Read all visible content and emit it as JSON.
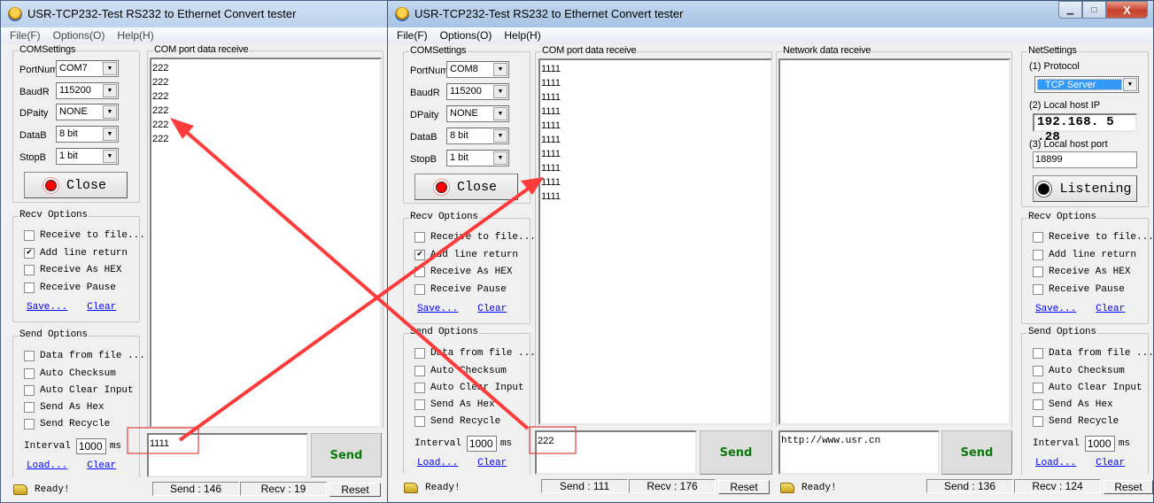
{
  "app": {
    "title": "USR-TCP232-Test  RS232 to Ethernet Convert tester",
    "menu": [
      "File(F)",
      "Options(O)",
      "Help(H)"
    ],
    "window_controls": {
      "minimize": "▁",
      "maximize": "□",
      "close": "X"
    }
  },
  "left_window": {
    "com_settings": {
      "label": "COMSettings",
      "fields": [
        {
          "label": "PortNum",
          "value": "COM7"
        },
        {
          "label": "BaudR",
          "value": "115200"
        },
        {
          "label": "DPaity",
          "value": "NONE"
        },
        {
          "label": "DataB",
          "value": "8 bit"
        },
        {
          "label": "StopB",
          "value": "1 bit"
        }
      ],
      "button_label": "Close"
    },
    "recv_options": {
      "label": "Recv Options",
      "items": [
        {
          "label": "Receive to file...",
          "checked": false
        },
        {
          "label": "Add line return",
          "checked": true
        },
        {
          "label": "Receive As HEX",
          "checked": false
        },
        {
          "label": "Receive Pause",
          "checked": false
        }
      ],
      "save_link": "Save...",
      "clear_link": "Clear"
    },
    "send_options": {
      "label": "Send Options",
      "items": [
        {
          "label": "Data from file ...",
          "checked": false
        },
        {
          "label": "Auto Checksum",
          "checked": false
        },
        {
          "label": "Auto Clear Input",
          "checked": false
        },
        {
          "label": "Send As Hex",
          "checked": false
        },
        {
          "label": "Send Recycle",
          "checked": false
        }
      ],
      "interval_label": "Interval",
      "interval_value": "1000",
      "interval_unit": "ms",
      "load_link": "Load...",
      "clear_link": "Clear"
    },
    "com_receive": {
      "label": "COM port data receive",
      "lines": [
        "222",
        "222",
        "222",
        "222",
        "222",
        "222"
      ]
    },
    "send_input": "1111",
    "send_button": "Send",
    "status": {
      "ready": "Ready!",
      "send_count": "Send : 146",
      "recv_count": "Recv : 19",
      "reset": "Reset"
    }
  },
  "right_window": {
    "com_settings": {
      "label": "COMSettings",
      "fields": [
        {
          "label": "PortNum",
          "value": "COM8"
        },
        {
          "label": "BaudR",
          "value": "115200"
        },
        {
          "label": "DPaity",
          "value": "NONE"
        },
        {
          "label": "DataB",
          "value": "8 bit"
        },
        {
          "label": "StopB",
          "value": "1 bit"
        }
      ],
      "button_label": "Close"
    },
    "recv_options": {
      "label": "Recv Options",
      "items": [
        {
          "label": "Receive to file...",
          "checked": false
        },
        {
          "label": "Add line return",
          "checked": true
        },
        {
          "label": "Receive As HEX",
          "checked": false
        },
        {
          "label": "Receive Pause",
          "checked": false
        }
      ],
      "save_link": "Save...",
      "clear_link": "Clear"
    },
    "send_options": {
      "label": "Send Options",
      "items": [
        {
          "label": "Data from file ...",
          "checked": false
        },
        {
          "label": "Auto Checksum",
          "checked": false
        },
        {
          "label": "Auto Clear Input",
          "checked": false
        },
        {
          "label": "Send As Hex",
          "checked": false
        },
        {
          "label": "Send Recycle",
          "checked": false
        }
      ],
      "interval_label": "Interval",
      "interval_value": "1000",
      "interval_unit": "ms",
      "load_link": "Load...",
      "clear_link": "Clear"
    },
    "com_receive": {
      "label": "COM port data receive",
      "lines": [
        "1111",
        "1111",
        "1111",
        "1111",
        "1111",
        "1111",
        "1111",
        "1111",
        "1111",
        "1111"
      ]
    },
    "com_send_input": "222",
    "com_send_button": "Send",
    "com_status": {
      "ready": "Ready!",
      "send_count": "Send : 111",
      "recv_count": "Recv : 176",
      "reset": "Reset"
    },
    "net_receive": {
      "label": "Network data receive",
      "lines": []
    },
    "net_send_input": "http://www.usr.cn",
    "net_send_button": "Send",
    "net_status": {
      "ready": "Ready!",
      "send_count": "Send : 136",
      "recv_count": "Recv : 124",
      "reset": "Reset"
    },
    "net_settings": {
      "label": "NetSettings",
      "protocol_label": "(1) Protocol",
      "protocol_value": "TCP Server",
      "ip_label": "(2) Local host IP",
      "ip_value": "192.168. 5 .28",
      "port_label": "(3) Local host port",
      "port_value": "18899",
      "listen_button": "Listening"
    },
    "net_recv_options": {
      "label": "Recv Options",
      "items": [
        {
          "label": "Receive to file...",
          "checked": false
        },
        {
          "label": "Add line return",
          "checked": false
        },
        {
          "label": "Receive As HEX",
          "checked": false
        },
        {
          "label": "Receive Pause",
          "checked": false
        }
      ],
      "save_link": "Save...",
      "clear_link": "Clear"
    },
    "net_send_options": {
      "label": "Send Options",
      "items": [
        {
          "label": "Data from file ...",
          "checked": false
        },
        {
          "label": "Auto Checksum",
          "checked": false
        },
        {
          "label": "Auto Clear Input",
          "checked": false
        },
        {
          "label": "Send As Hex",
          "checked": false
        },
        {
          "label": "Send Recycle",
          "checked": false
        }
      ],
      "interval_label": "Interval",
      "interval_value": "1000",
      "interval_unit": "ms",
      "load_link": "Load...",
      "clear_link": "Clear"
    }
  },
  "annotations": {
    "arrow_color": "#ff3b3b",
    "box_color": "#e04040"
  }
}
